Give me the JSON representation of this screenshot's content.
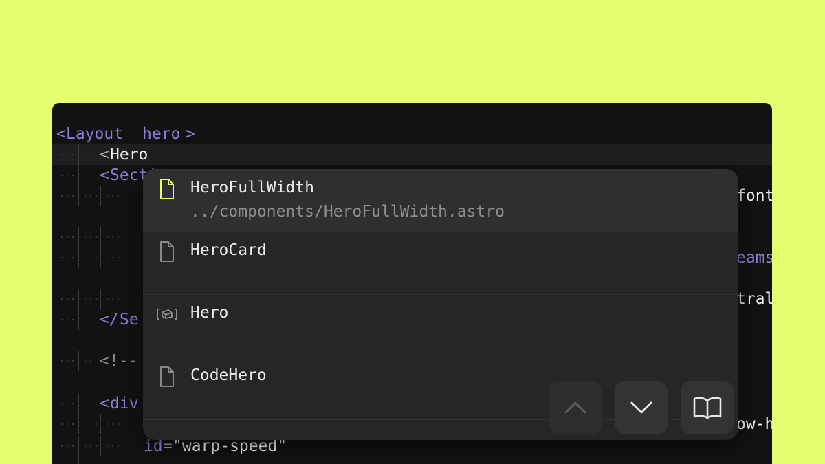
{
  "editor": {
    "lines": {
      "l0": {
        "open": "<",
        "tag": "Layout",
        "space": " ",
        "attr": "hero",
        "close": ">"
      },
      "l1": {
        "open": "<",
        "tag": "Hero"
      },
      "l2": {
        "open": "<",
        "tag": "Secti"
      },
      "l6": {
        "open": "</",
        "tag": "Se"
      },
      "l8": {
        "comment": "<!--"
      },
      "l10": {
        "open": "<",
        "tag": "div"
      },
      "l12": {
        "attr": "id",
        "eq": "=",
        "value": "\"warp-speed\""
      }
    },
    "right_fragments": {
      "r1": "font",
      "r2": "eams",
      "r3": "tral",
      "r4": "ow-h"
    }
  },
  "autocomplete": {
    "items": [
      {
        "label": "HeroFullWidth",
        "path": "../components/HeroFullWidth.astro",
        "icon": "file-icon",
        "selected": true
      },
      {
        "label": "HeroCard",
        "path": "",
        "icon": "file-icon",
        "selected": false
      },
      {
        "label": "Hero",
        "path": "",
        "icon": "component-icon",
        "selected": false
      },
      {
        "label": "CodeHero",
        "path": "",
        "icon": "file-icon",
        "selected": false
      }
    ],
    "buttons": {
      "up": {
        "icon": "chevron-up-icon",
        "disabled": true
      },
      "down": {
        "icon": "chevron-down-icon",
        "disabled": false
      },
      "docs": {
        "icon": "book-icon",
        "disabled": false
      }
    }
  },
  "colors": {
    "background": "#e4ff6f",
    "editor_bg": "#121212",
    "tag": "#8b7fd9",
    "selected_icon": "#e4ff6f"
  }
}
